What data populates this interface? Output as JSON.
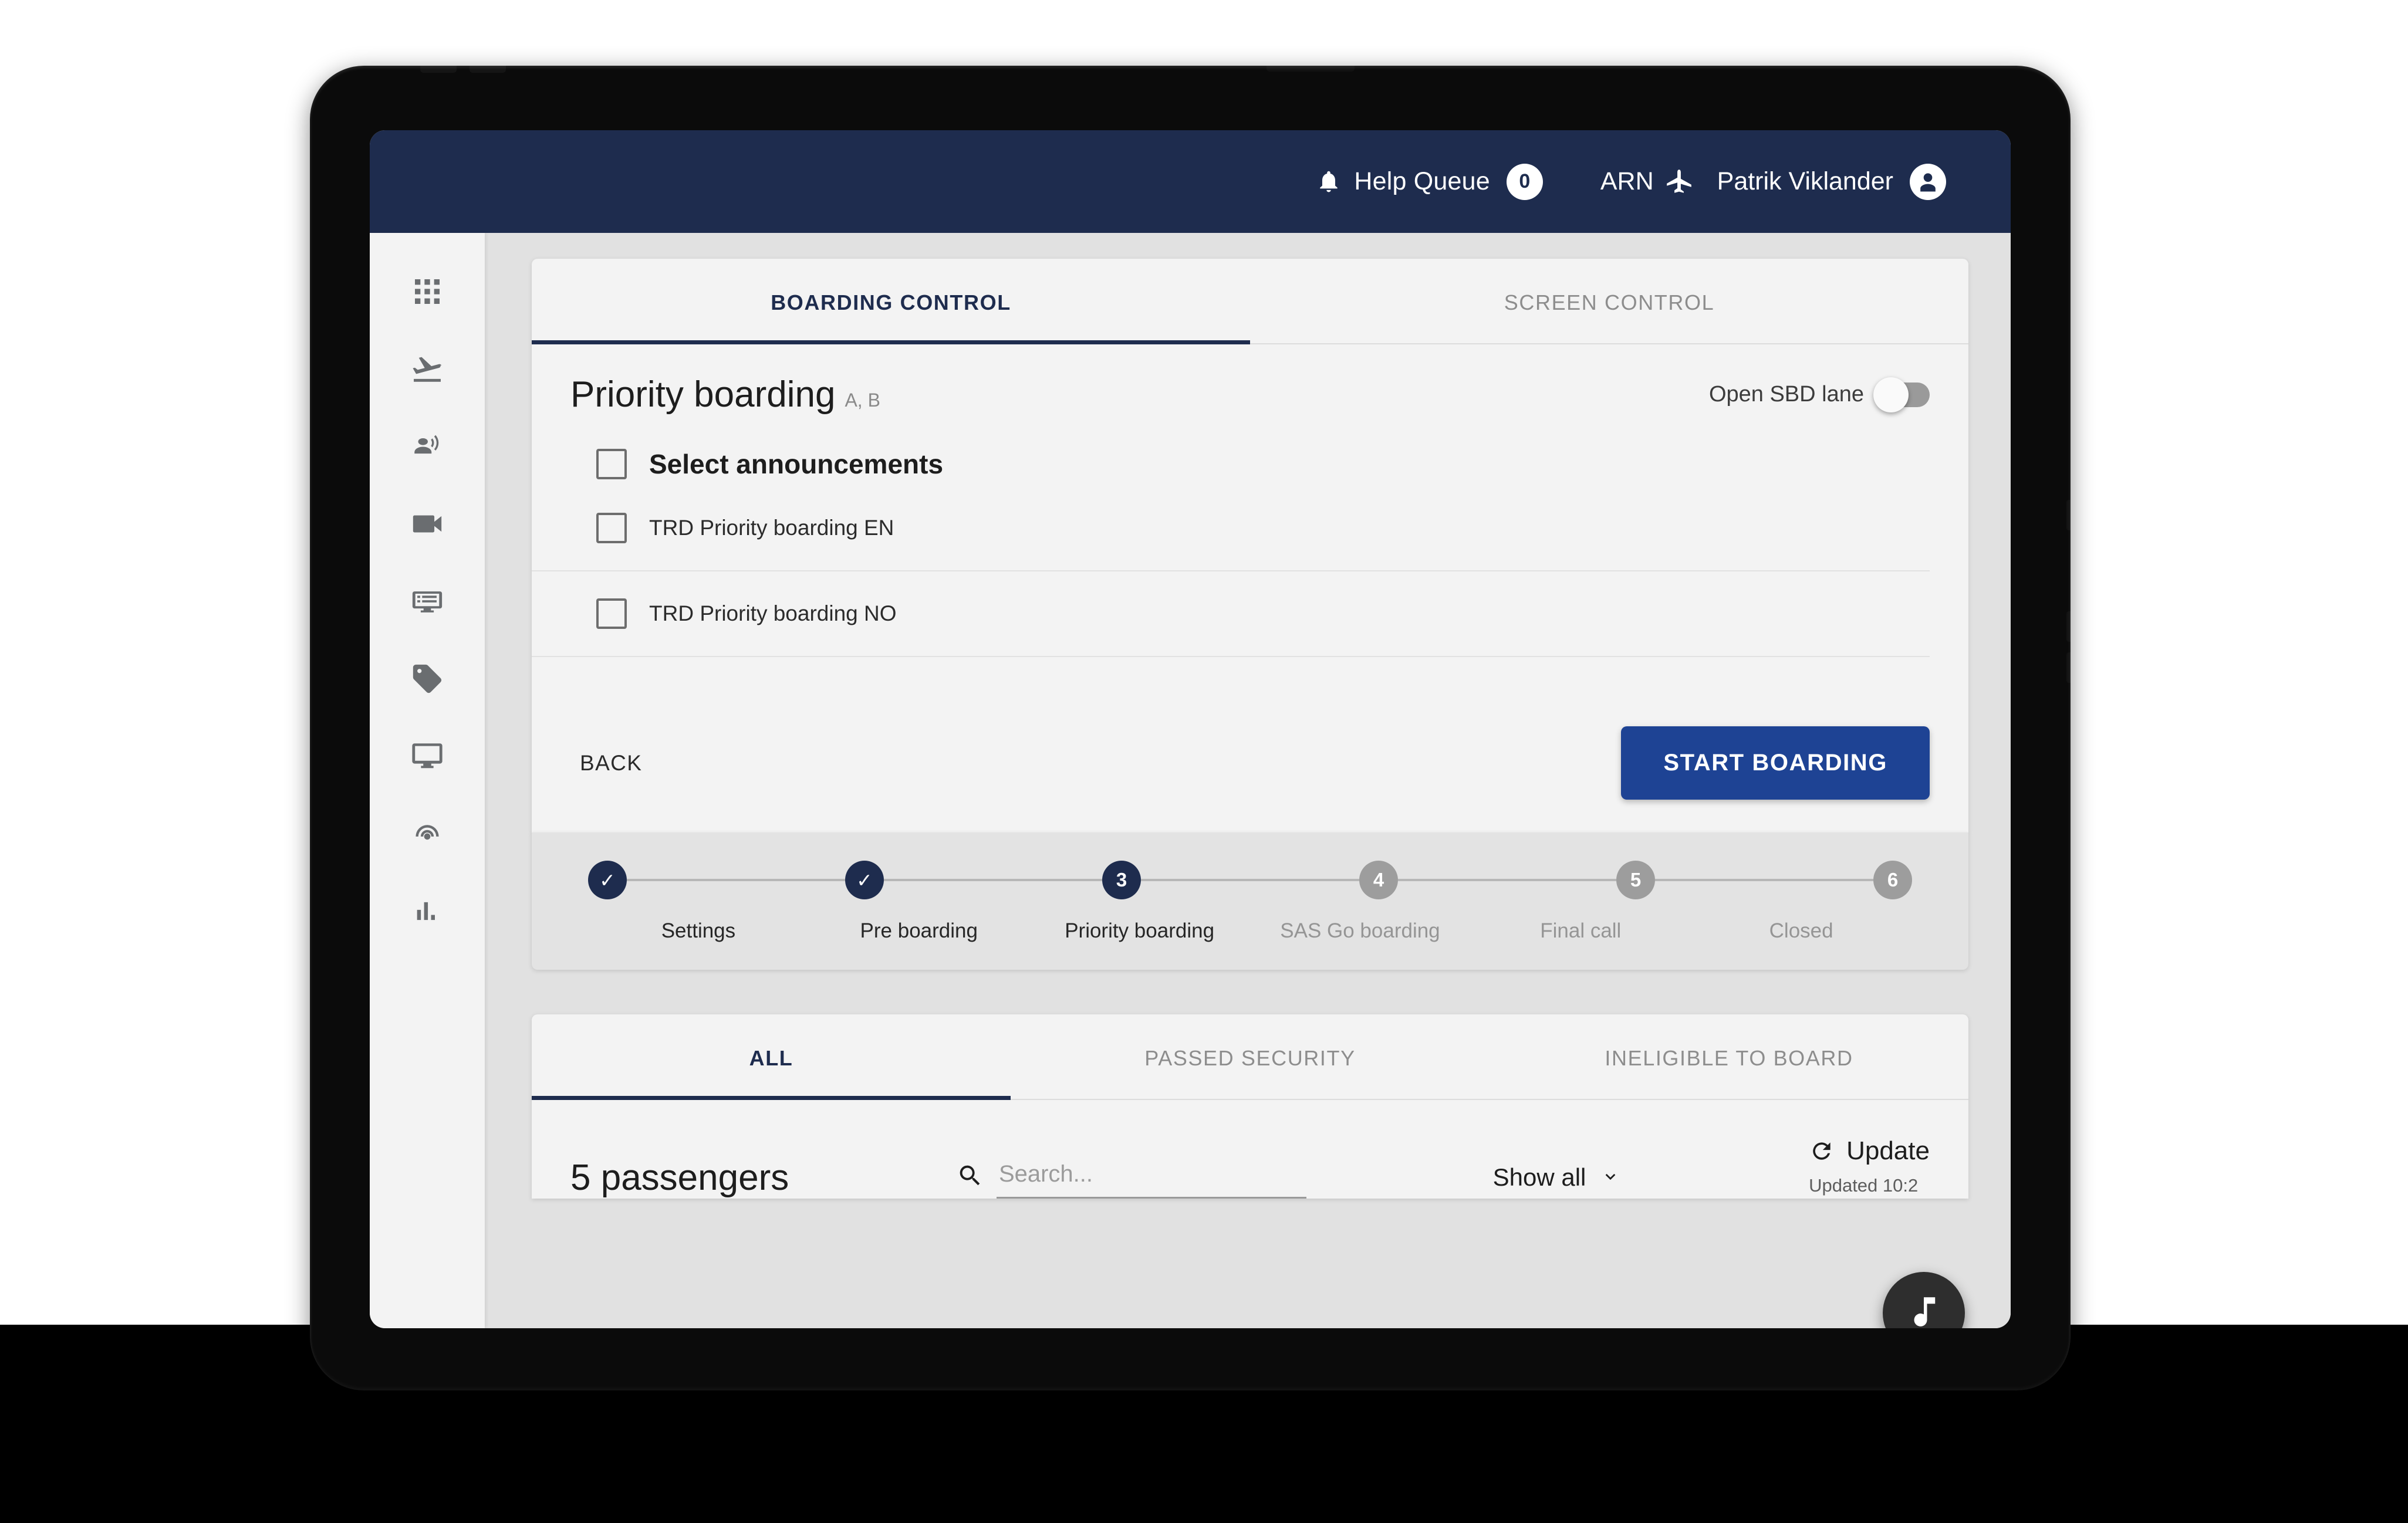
{
  "topbar": {
    "bell_icon": "bell-icon",
    "help_queue_label": "Help Queue",
    "help_queue_count": "0",
    "station_code": "ARN",
    "plane_icon": "airplane-icon",
    "user_name": "Patrik Viklander",
    "avatar_icon": "user-avatar-icon"
  },
  "sidebar": {
    "items": [
      {
        "icon": "apps-grid-icon",
        "name": "apps"
      },
      {
        "icon": "flight-takeoff-icon",
        "name": "flights"
      },
      {
        "icon": "announcement-person-icon",
        "name": "announcements"
      },
      {
        "icon": "video-camera-icon",
        "name": "video"
      },
      {
        "icon": "subtitles-screen-icon",
        "name": "messages"
      },
      {
        "icon": "tag-icon",
        "name": "tags"
      },
      {
        "icon": "monitor-icon",
        "name": "screens"
      },
      {
        "icon": "wifi-tethering-icon",
        "name": "broadcast"
      },
      {
        "icon": "bar-chart-icon",
        "name": "statistics"
      }
    ]
  },
  "main_tabs": [
    {
      "label": "BOARDING CONTROL",
      "active": true
    },
    {
      "label": "SCREEN CONTROL",
      "active": false
    }
  ],
  "boarding": {
    "title": "Priority boarding",
    "title_suffix": "A, B",
    "sbd_label": "Open SBD lane",
    "sbd_toggle_on": false,
    "select_announcements_label": "Select announcements",
    "announcements": [
      {
        "label": "TRD Priority boarding EN",
        "checked": false
      },
      {
        "label": "TRD Priority boarding NO",
        "checked": false
      }
    ],
    "back_label": "BACK",
    "start_label": "START BOARDING"
  },
  "stepper": {
    "steps": [
      {
        "marker": "✓",
        "label": "Settings",
        "state": "done"
      },
      {
        "marker": "✓",
        "label": "Pre boarding",
        "state": "done"
      },
      {
        "marker": "3",
        "label": "Priority boarding",
        "state": "current"
      },
      {
        "marker": "4",
        "label": "SAS Go boarding",
        "state": "todo"
      },
      {
        "marker": "5",
        "label": "Final call",
        "state": "todo"
      },
      {
        "marker": "6",
        "label": "Closed",
        "state": "todo"
      }
    ]
  },
  "pax_tabs": [
    {
      "label": "ALL",
      "active": true
    },
    {
      "label": "PASSED SECURITY",
      "active": false
    },
    {
      "label": "INELIGIBLE TO BOARD",
      "active": false
    }
  ],
  "passengers": {
    "count_label": "5 passengers",
    "search_placeholder": "Search...",
    "search_value": "",
    "show_all_label": "Show all",
    "update_label": "Update",
    "updated_at": "Updated 10:2"
  },
  "fab": {
    "icon": "music-note-icon"
  },
  "colors": {
    "navy": "#1e2c4e",
    "button_blue": "#1e4394",
    "panel": "#f3f3f3",
    "content_bg": "#e1e1e1",
    "step_todo": "#9d9d9d",
    "fab": "#2e2e2e"
  }
}
